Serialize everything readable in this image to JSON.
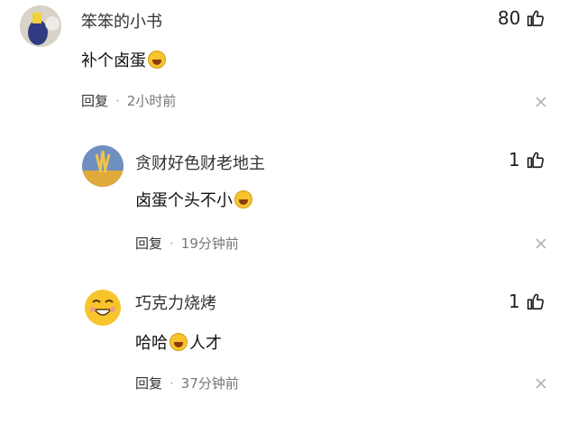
{
  "comments": [
    {
      "username": "笨笨的小书",
      "text": "补个卤蛋",
      "likes": "80",
      "reply_label": "回复",
      "separator": "·",
      "time": "2小时前",
      "icons": [
        "avatar-sticker",
        "laugh-cry-emoji",
        "thumbs-up-icon",
        "close-icon"
      ]
    },
    {
      "username": "贪财好色财老地主",
      "text": "卤蛋个头不小",
      "likes": "1",
      "reply_label": "回复",
      "separator": "·",
      "time": "19分钟前",
      "icons": [
        "avatar-wheat",
        "laugh-cry-emoji",
        "thumbs-up-icon",
        "close-icon"
      ]
    },
    {
      "username": "巧克力烧烤",
      "text_before": "哈哈",
      "text_after": "人才",
      "likes": "1",
      "reply_label": "回复",
      "separator": "·",
      "time": "37分钟前",
      "icons": [
        "avatar-yellow-face",
        "grin-emoji",
        "thumbs-up-icon",
        "close-icon"
      ]
    }
  ],
  "colors": {
    "emoji_yellow": "#f7c52b",
    "meta_text": "#777777"
  }
}
